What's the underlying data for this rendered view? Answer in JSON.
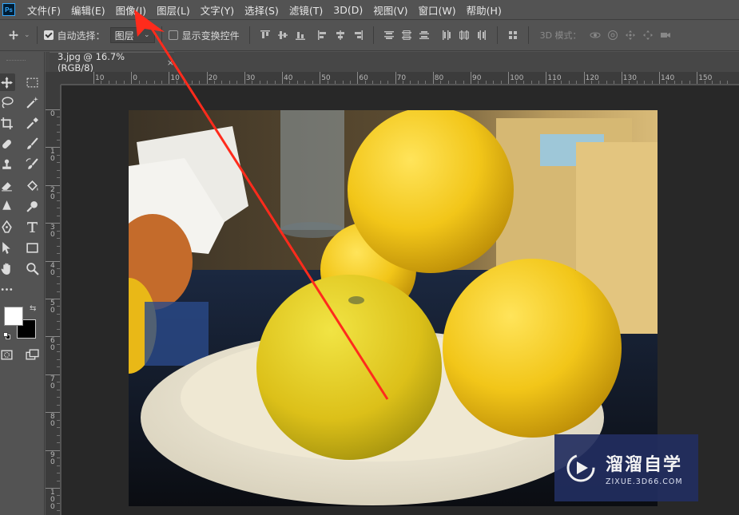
{
  "app": {
    "logo_text": "Ps"
  },
  "menu": {
    "items": [
      "文件(F)",
      "编辑(E)",
      "图像(I)",
      "图层(L)",
      "文字(Y)",
      "选择(S)",
      "滤镜(T)",
      "3D(D)",
      "视图(V)",
      "窗口(W)",
      "帮助(H)"
    ]
  },
  "options": {
    "auto_select_label": "自动选择：",
    "auto_select_checked": true,
    "layer_select_value": "图层",
    "show_transform_label": "显示变换控件",
    "show_transform_checked": false,
    "mode_3d_label": "3D 模式："
  },
  "document": {
    "tab_title": "3.jpg @ 16.7%(RGB/8)",
    "close_glyph": "×"
  },
  "rulers": {
    "top_labels": [
      "10",
      "0",
      "10",
      "20",
      "30",
      "40",
      "50",
      "60",
      "70",
      "80",
      "90",
      "100",
      "110",
      "120",
      "130",
      "140",
      "150"
    ],
    "left_labels": [
      "0",
      "1 0",
      "2 0",
      "3 0",
      "4 0",
      "5 0",
      "6 0",
      "7 0",
      "8 0",
      "9 0",
      "1 0 0"
    ]
  },
  "toolbar": {
    "foreground_color": "#ffffff",
    "background_color": "#000000"
  },
  "watermark": {
    "title": "溜溜自学",
    "subtitle": "ZIXUE.3D66.COM"
  },
  "colors": {
    "ui_background": "#535353",
    "canvas_background": "#282828",
    "annotation_arrow": "#ff2b1c",
    "watermark_bg": "#222e5f"
  }
}
